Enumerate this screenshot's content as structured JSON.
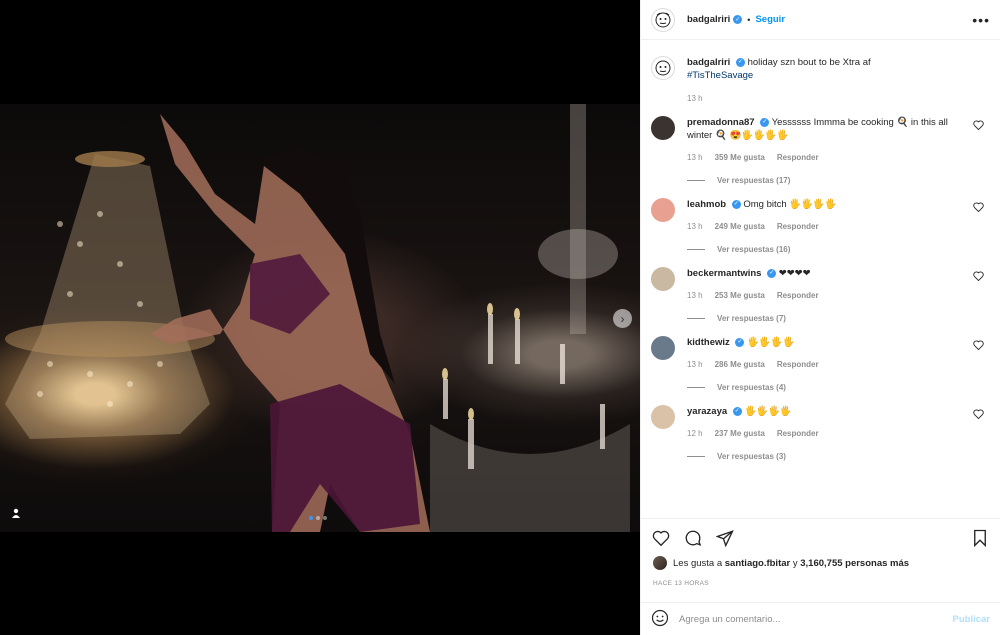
{
  "post": {
    "username": "badgalriri",
    "follow_label": "Seguir",
    "separator": "•",
    "caption": "holiday szn bout to be Xtra af",
    "hashtag": "#TisTheSavage",
    "caption_time": "13 h",
    "carousel": {
      "current": 1,
      "total": 3
    }
  },
  "comments": [
    {
      "username": "premadonna87",
      "text": "Yessssss Immma be cooking 🍳 in this all winter 🍳 😍🖐🖐🖐🖐",
      "time": "13 h",
      "likes": "359 Me gusta",
      "reply_label": "Responder",
      "replies": "Ver respuestas (17)",
      "avatar_color": "#3a3330"
    },
    {
      "username": "leahmob",
      "text": "Omg bitch 🖐🖐🖐🖐",
      "time": "13 h",
      "likes": "249 Me gusta",
      "reply_label": "Responder",
      "replies": "Ver respuestas (16)",
      "avatar_color": "#e8a090"
    },
    {
      "username": "beckermantwins",
      "text": "❤❤❤❤",
      "time": "13 h",
      "likes": "253 Me gusta",
      "reply_label": "Responder",
      "replies": "Ver respuestas (7)",
      "avatar_color": "#c9b8a2"
    },
    {
      "username": "kidthewiz",
      "text": "🖐🖐🖐🖐",
      "time": "13 h",
      "likes": "286 Me gusta",
      "reply_label": "Responder",
      "replies": "Ver respuestas (4)",
      "avatar_color": "#6b7a8a"
    },
    {
      "username": "yarazaya",
      "text": "🖐🖐🖐🖐",
      "time": "12 h",
      "likes": "237 Me gusta",
      "reply_label": "Responder",
      "replies": "Ver respuestas (3)",
      "avatar_color": "#d9c2a8"
    }
  ],
  "likes": {
    "prefix": "Les gusta a",
    "user": "santiago.fbitar",
    "joiner": "y",
    "others": "3,160,755 personas más"
  },
  "time_ago": "HACE 13 HORAS",
  "add_comment": {
    "placeholder": "Agrega un comentario...",
    "publish_label": "Publicar"
  },
  "colors": {
    "accent": "#0095f6",
    "verified": "#3897f0",
    "muted": "#8e8e8e",
    "text": "#262626"
  },
  "icons": [
    "heart-icon",
    "comment-icon",
    "share-icon",
    "bookmark-icon",
    "more-options-icon",
    "smiley-icon",
    "user-tag-icon",
    "chevron-right-icon",
    "verified-badge-icon"
  ]
}
